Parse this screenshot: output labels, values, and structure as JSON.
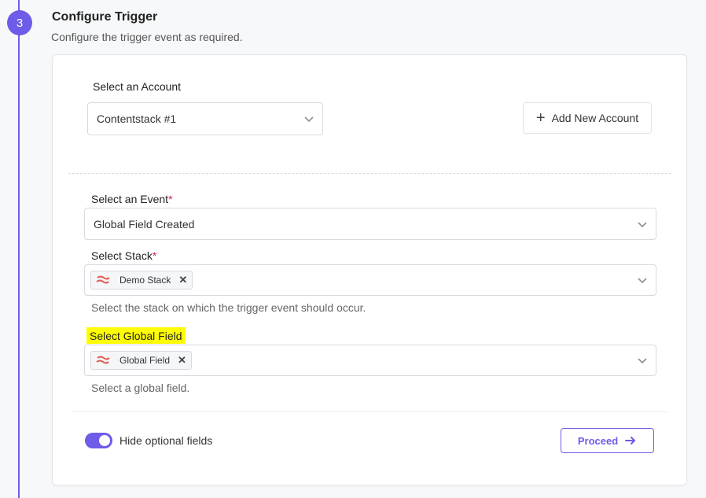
{
  "step": {
    "number": "3",
    "title": "Configure Trigger",
    "subtitle": "Configure the trigger event as required."
  },
  "account": {
    "label": "Select an Account",
    "value": "Contentstack #1",
    "add_button": "Add New Account"
  },
  "event": {
    "label": "Select an Event",
    "required_mark": "*",
    "value": "Global Field Created"
  },
  "stack": {
    "label": "Select Stack",
    "required_mark": "*",
    "chip": "Demo Stack",
    "help": "Select the stack on which the trigger event should occur."
  },
  "global_field": {
    "label": "Select Global Field",
    "chip": "Global Field",
    "help": "Select a global field.",
    "highlight_color": "#ffff00"
  },
  "footer": {
    "toggle_label": "Hide optional fields",
    "toggle_on": true,
    "proceed": "Proceed"
  },
  "colors": {
    "accent": "#6c5ce7",
    "required": "#d1234b",
    "chip_icon": "#e05a4e"
  },
  "icons": {
    "add": "plus-icon",
    "dropdown": "chevron-down-icon",
    "chip_logo": "contentstack-logo-icon",
    "remove": "close-icon",
    "proceed": "arrow-right-icon"
  }
}
